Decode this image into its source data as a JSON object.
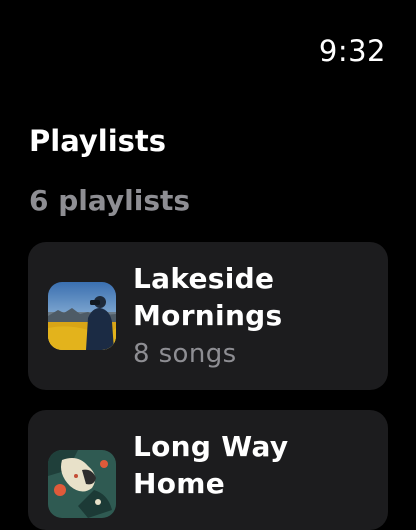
{
  "status": {
    "time": "9:32"
  },
  "header": {
    "title": "Playlists",
    "count": "6 playlists"
  },
  "playlists": [
    {
      "title": "Lakeside Mornings",
      "songs": "8 songs",
      "artwork_icon": "lake-photo-artwork"
    },
    {
      "title": "Long Way Home",
      "songs": "",
      "artwork_icon": "abstract-art-artwork"
    }
  ],
  "colors": {
    "background": "#000000",
    "card": "#1c1c1e",
    "secondary_text": "#8e8e93"
  }
}
